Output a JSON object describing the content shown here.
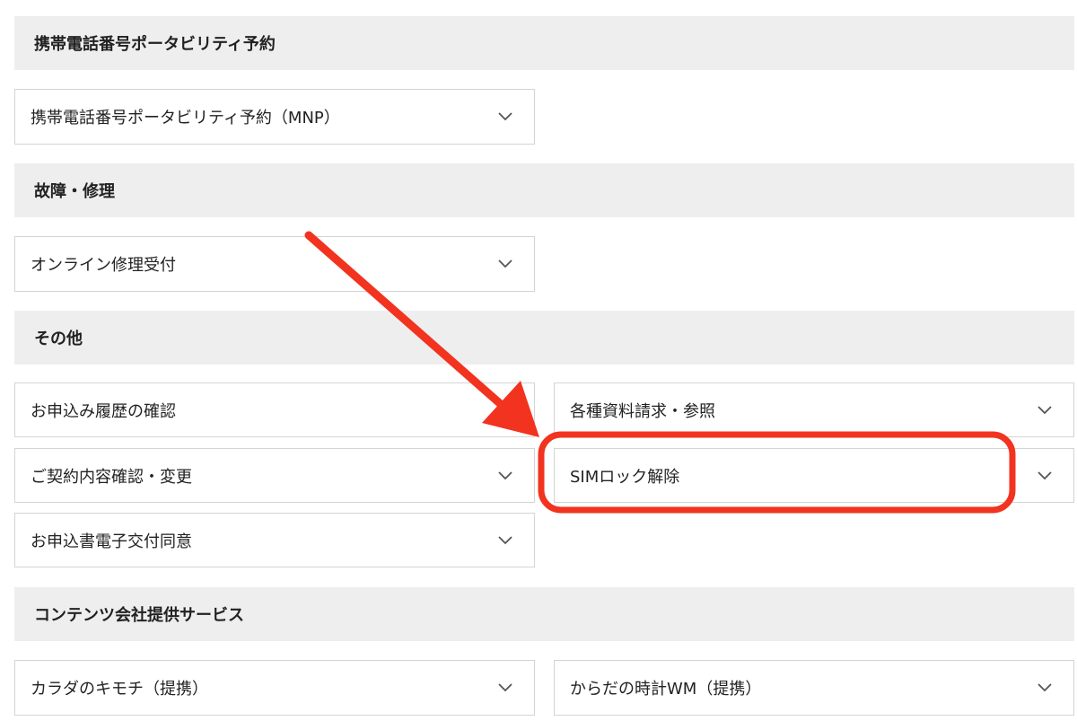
{
  "sections": [
    {
      "title": "携帯電話番号ポータビリティ予約"
    },
    {
      "title": "故障・修理"
    },
    {
      "title": "その他"
    },
    {
      "title": "コンテンツ会社提供サービス"
    }
  ],
  "items": {
    "mnp": "携帯電話番号ポータビリティ予約（MNP）",
    "online_repair": "オンライン修理受付",
    "application_history": "お申込み履歴の確認",
    "document_request": "各種資料請求・参照",
    "contract_change": "ご契約内容確認・変更",
    "sim_unlock": "SIMロック解除",
    "e_document_consent": "お申込書電子交付同意",
    "karada_kimochi": "カラダのキモチ（提携）",
    "karada_tokei": "からだの時計WM（提携）"
  },
  "icons": {
    "expand": "chevron-down-icon",
    "annotation_arrow": "arrow-icon"
  },
  "colors": {
    "section_bg": "#eeeeee",
    "annotation": "#f2331f"
  }
}
